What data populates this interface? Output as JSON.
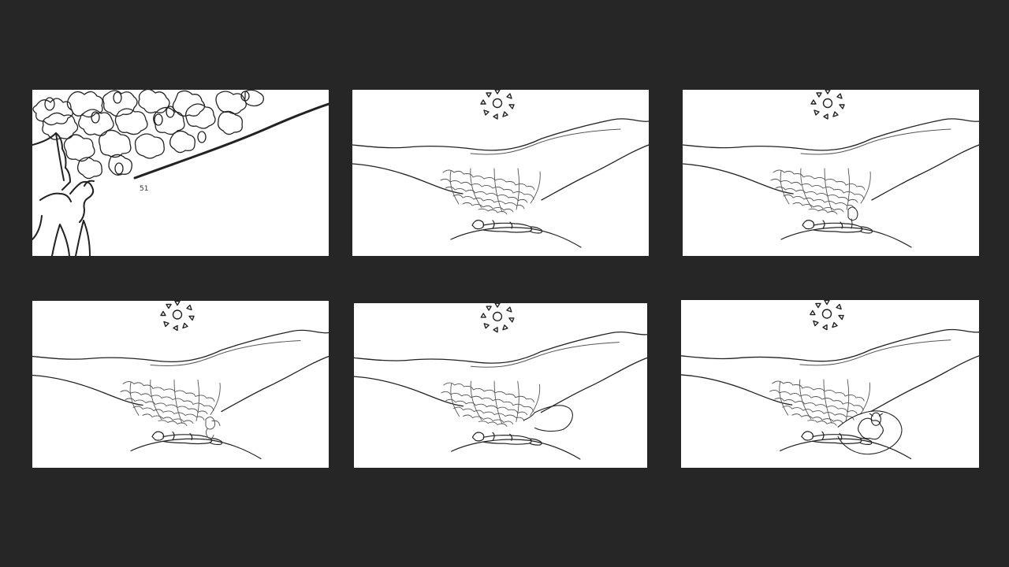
{
  "storyboard": {
    "background_color": "#262626",
    "panel_color": "#ffffff",
    "ink_color": "#222222",
    "panels": [
      {
        "id": "p1",
        "label": "51"
      },
      {
        "id": "p2",
        "label": ""
      },
      {
        "id": "p3",
        "label": ""
      },
      {
        "id": "p4",
        "label": ""
      },
      {
        "id": "p5",
        "label": ""
      },
      {
        "id": "p6",
        "label": ""
      }
    ]
  }
}
